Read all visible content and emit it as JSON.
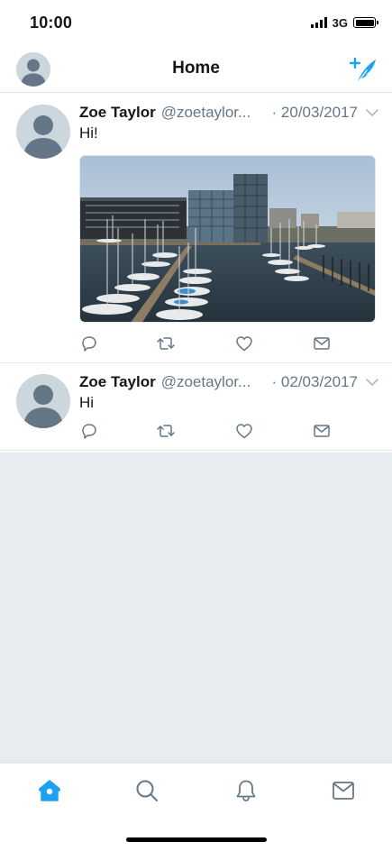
{
  "status_bar": {
    "time": "10:00",
    "network": "3G",
    "icons": [
      "signal-bars-icon",
      "battery-icon"
    ]
  },
  "header": {
    "title": "Home",
    "left_icon": "profile-avatar",
    "right_icon": "compose-tweet-icon"
  },
  "timeline": {
    "tweets": [
      {
        "name": "Zoe Taylor",
        "handle": "@zoetaylor...",
        "date": "· 20/03/2017",
        "text": "Hi!",
        "has_media": true,
        "media_description_icon": "harbor-photo"
      },
      {
        "name": "Zoe Taylor",
        "handle": "@zoetaylor...",
        "date": "· 02/03/2017",
        "text": "Hi",
        "has_media": false
      }
    ],
    "action_icons": [
      "reply-icon",
      "retweet-icon",
      "like-icon",
      "direct-message-icon"
    ]
  },
  "tab_bar": {
    "tabs": [
      {
        "icon": "home-icon",
        "active": true
      },
      {
        "icon": "search-icon",
        "active": false
      },
      {
        "icon": "notifications-icon",
        "active": false
      },
      {
        "icon": "messages-icon",
        "active": false
      }
    ]
  },
  "colors": {
    "accent": "#1da1f2",
    "text": "#14171a",
    "secondary_text": "#657786",
    "divider": "#e1e8ed",
    "background_empty": "#e6ecf0",
    "avatar_bg": "#ccd6dd",
    "avatar_fg": "#657786"
  }
}
